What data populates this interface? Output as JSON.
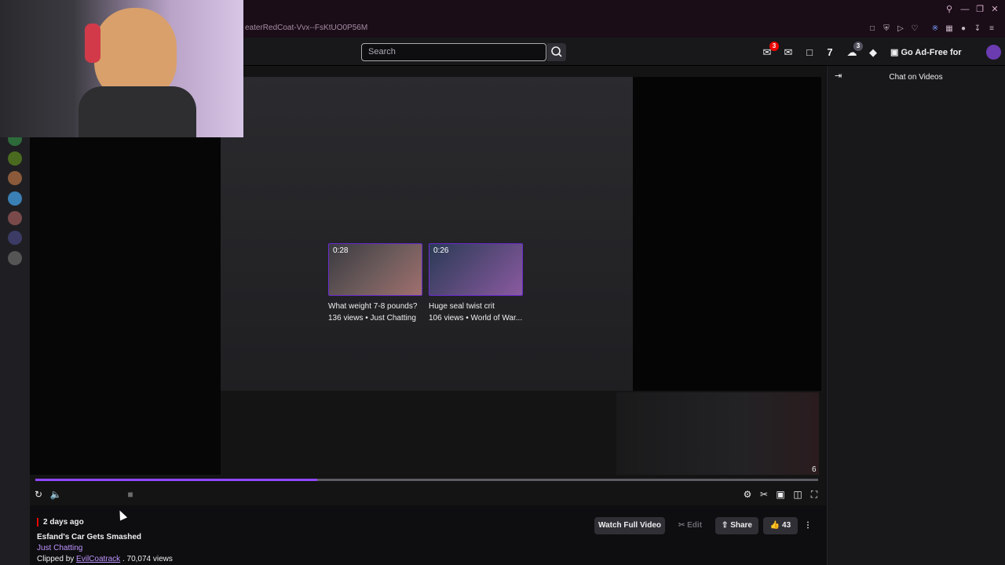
{
  "browser": {
    "url": "eaterRedCoat-Vvx--FsKtUO0P56M"
  },
  "topnav": {
    "search_placeholder": "Search",
    "notifications_count": "3",
    "presence_count": "3",
    "adfree_label": "Go Ad-Free for Free"
  },
  "player": {
    "elapsed_fraction": 0.36,
    "counter": "6",
    "related_clips": [
      {
        "duration": "0:28",
        "title": "What weight 7-8 pounds?",
        "meta": "136 views • Just Chatting"
      },
      {
        "duration": "0:26",
        "title": "Huge seal twist crit",
        "meta": "106 views • World of War..."
      }
    ]
  },
  "chat": {
    "title": "Chat on Videos"
  },
  "clip": {
    "age": "2 days ago",
    "title": "Esfand's Car Gets Smashed",
    "category": "Just Chatting",
    "clipped_by_prefix": "Clipped by",
    "clipper": "EvilCoatrack",
    "views": ". 70,074 views"
  },
  "actions": {
    "watch_full": "Watch Full Video",
    "edit": "Edit",
    "share": "Share",
    "likes": "43"
  },
  "colors": {
    "accent": "#9147ff",
    "link": "#bf94ff",
    "live_red": "#eb0400"
  }
}
